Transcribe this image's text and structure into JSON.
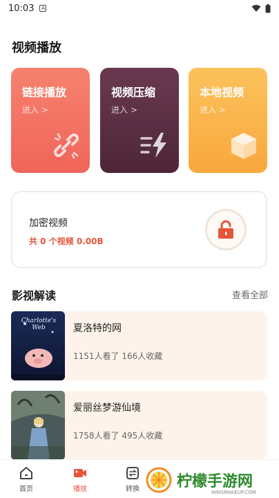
{
  "status": {
    "time": "10:03",
    "notification": "A"
  },
  "section_video": {
    "title": "视频播放"
  },
  "cards": [
    {
      "title": "链接播放",
      "sub": "进入 >"
    },
    {
      "title": "视频压缩",
      "sub": "进入 >"
    },
    {
      "title": "本地视频",
      "sub": "进入 >"
    }
  ],
  "encrypted": {
    "title": "加密视频",
    "stats": "共 0 个视频 0.00B"
  },
  "section_reviews": {
    "title": "影视解读",
    "view_all": "查看全部"
  },
  "movies": [
    {
      "title": "夏洛特的网",
      "stats": "1151人看了 166人收藏",
      "poster_text": "Charlotte's Web"
    },
    {
      "title": "爱丽丝梦游仙境",
      "stats": "1758人看了 495人收藏"
    }
  ],
  "nav": [
    {
      "label": "首页"
    },
    {
      "label": "播放"
    },
    {
      "label": "转换"
    }
  ],
  "watermark": {
    "text": "柠檬手游网",
    "sub": "NINGMAKEUP.COM"
  },
  "colors": {
    "accent": "#e5553a",
    "card_link": "#f0655a",
    "card_compress": "#4e2638",
    "card_local": "#f8a83c"
  }
}
